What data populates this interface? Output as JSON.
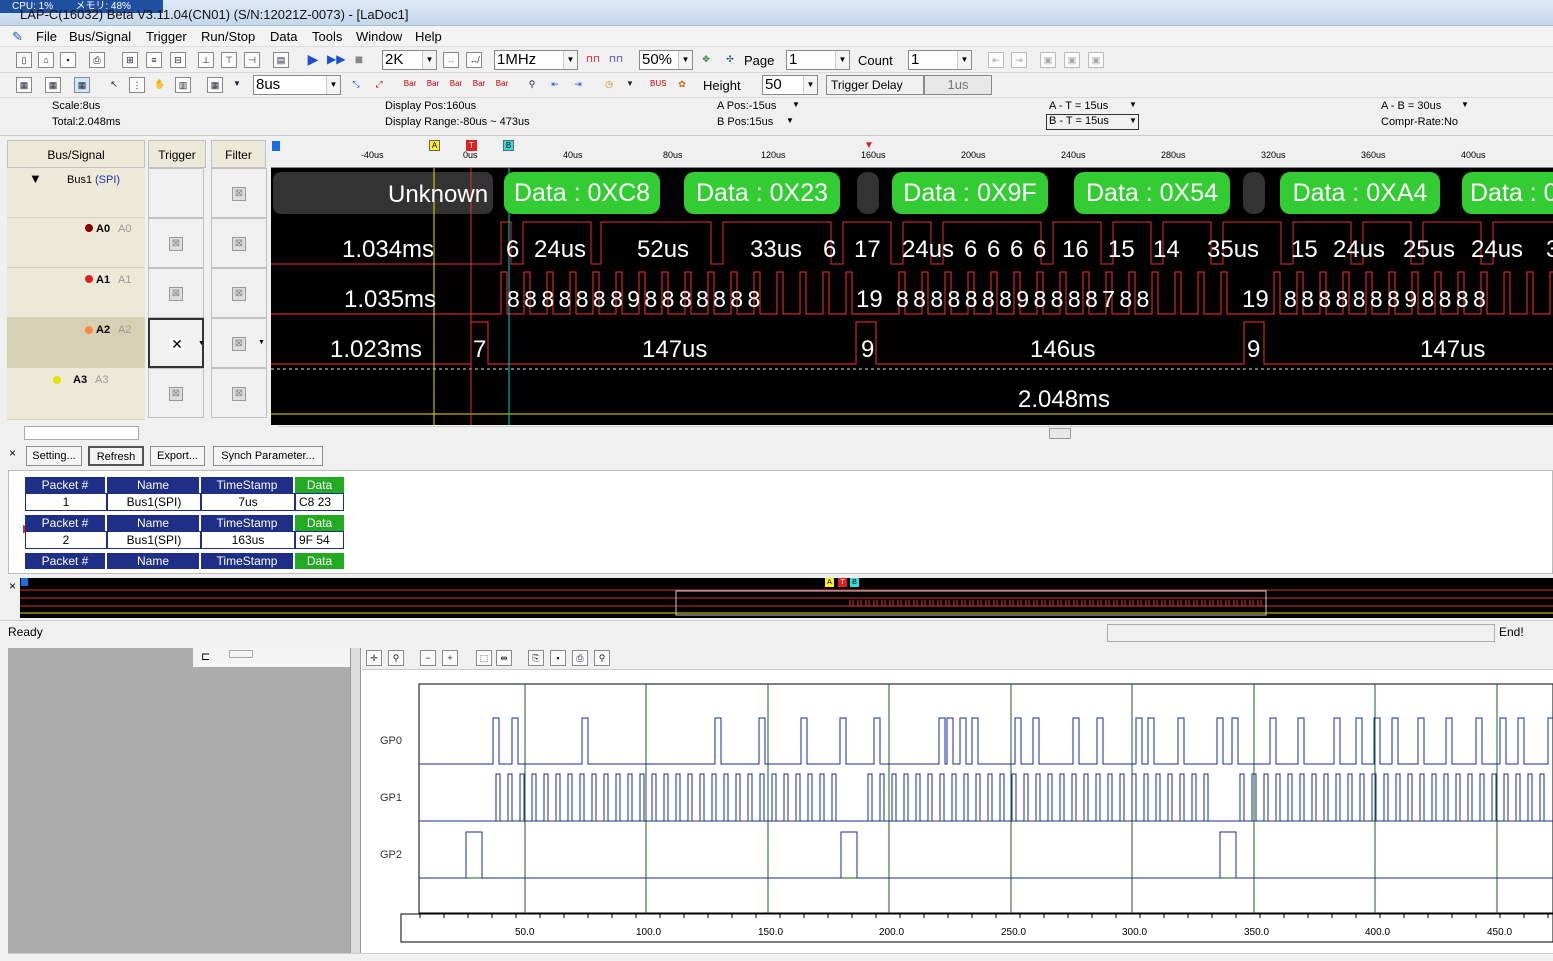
{
  "titlebar": {
    "cpu": "CPU: 1%",
    "memory": "メモリ: 48%",
    "title": "LAP-C(16032) Beta V3.11.04(CN01) (S/N:12021Z-0073) - [LaDoc1]"
  },
  "menu": [
    "File",
    "Bus/Signal",
    "Trigger",
    "Run/Stop",
    "Data",
    "Tools",
    "Window",
    "Help"
  ],
  "toolbar1": {
    "memory_depth": "2K",
    "sample_rate": "1MHz",
    "trigger_pos": "50%",
    "page_label": "Page",
    "page_value": "1",
    "count_label": "Count",
    "count_value": "1"
  },
  "toolbar2": {
    "scale_value": "8us",
    "height_label": "Height",
    "height_value": "50",
    "trigger_delay_label": "Trigger Delay",
    "trigger_delay_value": "1us"
  },
  "info": {
    "scale": "Scale:8us",
    "total": "Total:2.048ms",
    "display_pos": "Display Pos:160us",
    "display_range": "Display Range:-80us ~ 473us",
    "a_pos": "A Pos:-15us",
    "b_pos": "B Pos:15us",
    "a_t": "A - T = 15us",
    "b_t": "B - T = 15us",
    "a_b": "A - B = 30us",
    "compr_rate": "Compr-Rate:No"
  },
  "columns": {
    "bus_signal": "Bus/Signal",
    "trigger": "Trigger",
    "filter": "Filter"
  },
  "signals": [
    {
      "name": "Bus1",
      "sub": "(SPI)",
      "color": "#2233aa"
    },
    {
      "name": "A0",
      "sub": "A0",
      "color": "#8b0000"
    },
    {
      "name": "A1",
      "sub": "A1",
      "color": "#e02020"
    },
    {
      "name": "A2",
      "sub": "A2",
      "color": "#ff8844"
    },
    {
      "name": "A3",
      "sub": "A3",
      "color": "#e8e000"
    }
  ],
  "ruler": {
    "markers": [
      "A",
      "T",
      "B"
    ],
    "ticks": [
      "-40us",
      "0us",
      "40us",
      "80us",
      "120us",
      "160us",
      "200us",
      "240us",
      "280us",
      "320us",
      "360us",
      "400us"
    ]
  },
  "wave": {
    "bus_unknown": "Unknown",
    "bus_packets": [
      "Data : 0XC8",
      "Data : 0X23",
      "Data : 0X9F",
      "Data : 0X54",
      "Data : 0XA4",
      "Data : 0"
    ],
    "a0": [
      "1.034ms",
      "6",
      "24us",
      "52us",
      "33us",
      "6",
      "17",
      "24us",
      "6",
      "6",
      "6",
      "6",
      "16",
      "15",
      "14",
      "35us",
      "15",
      "24us",
      "25us",
      "24us",
      "3"
    ],
    "a1_label": "1.035ms",
    "a1_digits": "8 8 8 8 8 8 8 9 8 8 8 8 8 8 8",
    "a1_19a": "19",
    "a1_digits2": "8 8 8 8 8 8 8 9 8 8 8 8 7 8 8",
    "a1_19b": "19",
    "a1_digits3": "8 8 8 8 8 8 8 9 8 8 8 8",
    "a2": [
      "1.023ms",
      "7",
      "147us",
      "9",
      "146us",
      "9",
      "147us"
    ],
    "a3": "2.048ms"
  },
  "packet_panel": {
    "buttons": [
      "Setting...",
      "Refresh",
      "Export...",
      "Synch Parameter..."
    ],
    "headers": [
      "Packet #",
      "Name",
      "TimeStamp",
      "Data"
    ],
    "rows": [
      {
        "num": "1",
        "name": "Bus1(SPI)",
        "ts": "7us",
        "data": "C8  23"
      },
      {
        "num": "2",
        "name": "Bus1(SPI)",
        "ts": "163us",
        "data": "9F  54"
      }
    ]
  },
  "status": {
    "left": "Ready",
    "right": "End!"
  },
  "plot": {
    "channels": [
      "GP0",
      "GP1",
      "GP2"
    ],
    "x_ticks": [
      "50.0",
      "100.0",
      "150.0",
      "200.0",
      "250.0",
      "300.0",
      "350.0",
      "400.0",
      "450.0"
    ]
  }
}
